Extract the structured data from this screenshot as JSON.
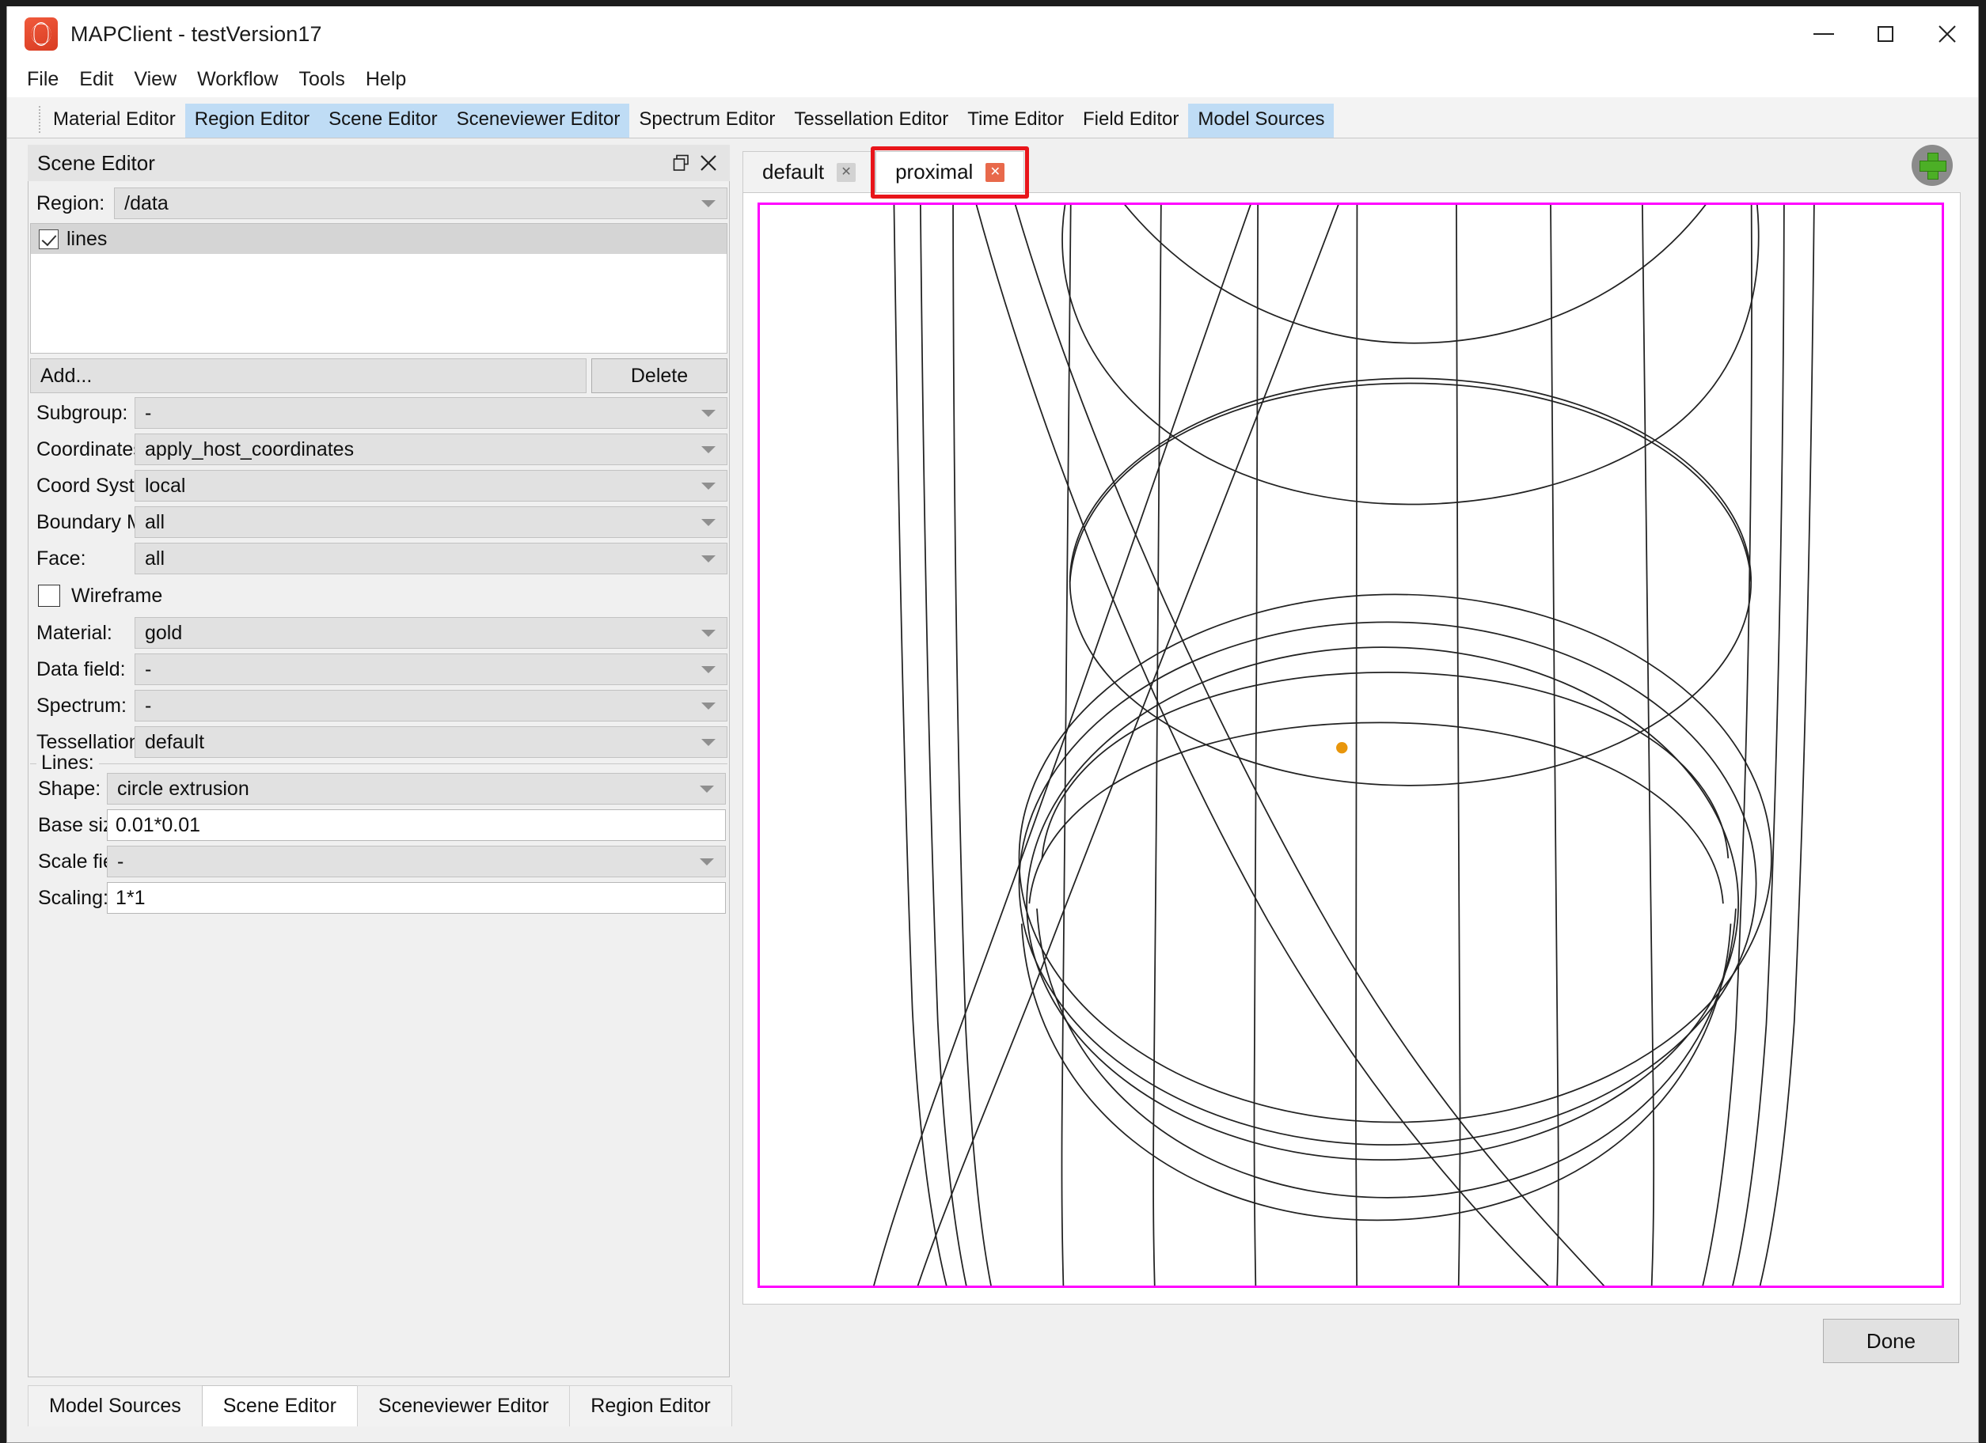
{
  "window": {
    "title": "MAPClient - testVersion17",
    "app_icon": "mapclient-logo-icon",
    "controls": {
      "minimize": "minimize-icon",
      "maximize": "maximize-icon",
      "close": "close-icon"
    }
  },
  "menu": {
    "items": [
      "File",
      "Edit",
      "View",
      "Workflow",
      "Tools",
      "Help"
    ]
  },
  "editor_tabs": [
    {
      "label": "Material Editor",
      "selected": false
    },
    {
      "label": "Region Editor",
      "selected": true
    },
    {
      "label": "Scene Editor",
      "selected": true
    },
    {
      "label": "Sceneviewer Editor",
      "selected": true
    },
    {
      "label": "Spectrum Editor",
      "selected": false
    },
    {
      "label": "Tessellation Editor",
      "selected": false
    },
    {
      "label": "Time Editor",
      "selected": false
    },
    {
      "label": "Field Editor",
      "selected": false
    },
    {
      "label": "Model Sources",
      "selected": true
    }
  ],
  "scene_editor": {
    "dock_title": "Scene Editor",
    "float_icon": "restore-window-icon",
    "close_icon": "close-icon",
    "region_label": "Region:",
    "region_value": "/data",
    "graphics_items": [
      {
        "label": "lines",
        "checked": true,
        "selected": true
      }
    ],
    "add_label": "Add...",
    "delete_label": "Delete",
    "properties": [
      {
        "label": "Subgroup:",
        "value": "-",
        "kind": "combo"
      },
      {
        "label": "Coordinates:",
        "value": "apply_host_coordinates",
        "kind": "combo"
      },
      {
        "label": "Coord System:",
        "value": "local",
        "kind": "combo"
      },
      {
        "label": "Boundary Mode:",
        "value": "all",
        "kind": "combo"
      },
      {
        "label": "Face:",
        "value": "all",
        "kind": "combo"
      }
    ],
    "wireframe_label": "Wireframe",
    "wireframe_checked": false,
    "properties2": [
      {
        "label": "Material:",
        "value": "gold",
        "kind": "combo"
      },
      {
        "label": "Data field:",
        "value": "-",
        "kind": "combo"
      },
      {
        "label": "Spectrum:",
        "value": "-",
        "kind": "combo"
      },
      {
        "label": "Tessellation:",
        "value": "default",
        "kind": "combo"
      }
    ],
    "lines_group": {
      "title": "Lines:",
      "fields": [
        {
          "label": "Shape:",
          "value": "circle extrusion",
          "kind": "combo"
        },
        {
          "label": "Base size:",
          "value": "0.01*0.01",
          "kind": "text"
        },
        {
          "label": "Scale field:",
          "value": "-",
          "kind": "combo"
        },
        {
          "label": "Scaling:",
          "value": "1*1",
          "kind": "text"
        }
      ]
    }
  },
  "viewer": {
    "tabs": [
      {
        "label": "default",
        "active": false,
        "close_icon": "close-tab-icon"
      },
      {
        "label": "proximal",
        "active": true,
        "close_icon": "close-tab-icon"
      }
    ],
    "add_button_icon": "add-view-plus-icon",
    "annotation_color": "#e8151a",
    "canvas_border_color": "#ff00ff",
    "marker_color": "#e8960c"
  },
  "done_label": "Done",
  "bottom_tabs": [
    {
      "label": "Model Sources",
      "active": false
    },
    {
      "label": "Scene Editor",
      "active": true
    },
    {
      "label": "Sceneviewer Editor",
      "active": false
    },
    {
      "label": "Region Editor",
      "active": false
    }
  ]
}
